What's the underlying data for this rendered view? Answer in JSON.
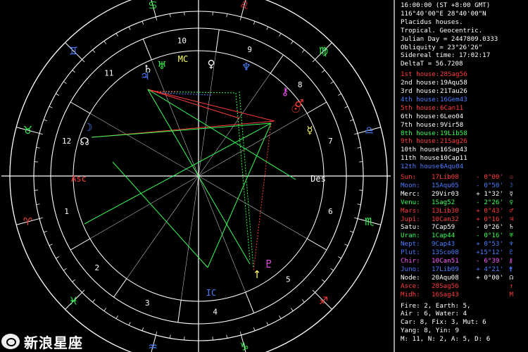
{
  "header": {
    "lines": [
      "16:00:00 (ST +8:00 GMT)",
      "116°40'00\"E 28°40'00\"N",
      "Placidus houses.",
      "Tropical. Geocentric.",
      "Julian Day = 2447809.0333",
      "Obliquity = 23°26'26\"",
      "Sidereal time: 17:02:17",
      "DeltaT = 56.7208"
    ]
  },
  "houses": [
    {
      "label": "1st house:",
      "value": "28Sag56",
      "color": "#ff3b3b"
    },
    {
      "label": "2nd house:",
      "value": "19Aqu58",
      "color": "#ffffff"
    },
    {
      "label": "3rd house:",
      "value": "21Tau26",
      "color": "#ffffff"
    },
    {
      "label": "4th house:",
      "value": "16Gem43",
      "color": "#4d7dff"
    },
    {
      "label": "5th house:",
      "value": "6Can11",
      "color": "#ff3b3b"
    },
    {
      "label": "6th house:",
      "value": "6Leo04",
      "color": "#ffffff"
    },
    {
      "label": "7th house:",
      "value": "9Vir58",
      "color": "#ffffff"
    },
    {
      "label": "8th house:",
      "value": "19Lib58",
      "color": "#33ff55"
    },
    {
      "label": "9th house:",
      "value": "21Sag26",
      "color": "#ff3b3b"
    },
    {
      "label": "10th house:",
      "value": "16Sag43",
      "color": "#ffffff"
    },
    {
      "label": "11th house:",
      "value": "10Cap11",
      "color": "#ffffff"
    },
    {
      "label": "12th house:",
      "value": "6Aqu04",
      "color": "#4d7dff"
    }
  ],
  "planets": [
    {
      "name": "Sun:",
      "pos": "17Lib08",
      "lat": "- 0°00'",
      "color": "#ff3b3b",
      "glyph": "☉"
    },
    {
      "name": "Moon:",
      "pos": "15Aqu05",
      "lat": "- 0°50'",
      "color": "#4d7dff",
      "glyph": "☽"
    },
    {
      "name": "Merc:",
      "pos": "29Vir03",
      "lat": "+ 1°32'",
      "color": "#ffffff",
      "glyph": "☿"
    },
    {
      "name": "Venu:",
      "pos": "1Sag52",
      "lat": "- 2°26'",
      "color": "#33ff55",
      "glyph": "♀"
    },
    {
      "name": "Mars:",
      "pos": "13Lib30",
      "lat": "+ 0°43'",
      "color": "#ff3b3b",
      "glyph": "♂"
    },
    {
      "name": "Jupi:",
      "pos": "10Can32",
      "lat": "+ 0°16'",
      "color": "#ff3b3b",
      "glyph": "♃"
    },
    {
      "name": "Satu:",
      "pos": "7Cap59",
      "lat": "- 0°26'",
      "color": "#ffffff",
      "glyph": "♄"
    },
    {
      "name": "Uran:",
      "pos": "1Cap44",
      "lat": "- 0°16'",
      "color": "#33ff55",
      "glyph": "♅"
    },
    {
      "name": "Nept:",
      "pos": "9Cap43",
      "lat": "+ 0°53'",
      "color": "#4d7dff",
      "glyph": "♆"
    },
    {
      "name": "Plut:",
      "pos": "13Sco08",
      "lat": "+15°12'",
      "color": "#4d7dff",
      "glyph": "♇"
    },
    {
      "name": "Chir:",
      "pos": "10Can51",
      "lat": "- 6°39'",
      "color": "#ff55ff",
      "glyph": "⚷"
    },
    {
      "name": "Juno:",
      "pos": "17Lib09",
      "lat": "+ 4°21'",
      "color": "#4d7dff",
      "glyph": "⚵"
    },
    {
      "name": "Node:",
      "pos": "20Aqu08",
      "lat": "+ 0°00'",
      "color": "#ffffff",
      "glyph": "☊"
    },
    {
      "name": "Asce:",
      "pos": "28Sag56",
      "lat": "",
      "color": "#ff3b3b",
      "glyph": "↑"
    },
    {
      "name": "Midh:",
      "pos": "16Sag43",
      "lat": "",
      "color": "#ff3b3b",
      "glyph": "M"
    }
  ],
  "footer": {
    "lines": [
      "Fire: 2, Earth: 5,",
      "Air : 6, Water: 4",
      "Car: 8, Fix: 3, Mut: 6",
      "Yang: 8, Yin: 9",
      "M: 11, N: 2, A: 5, D: 6"
    ]
  },
  "wheel": {
    "angle_labels": {
      "asc": "Asc",
      "desc": "Des",
      "mc": "MC",
      "ic": "IC"
    },
    "house_numbers": [
      "1",
      "2",
      "3",
      "4",
      "5",
      "6",
      "7",
      "8",
      "9",
      "10",
      "11",
      "12"
    ],
    "signs": [
      {
        "glyph": "♈",
        "color": "#ff3b3b"
      },
      {
        "glyph": "♉",
        "color": "#33ff55"
      },
      {
        "glyph": "♊",
        "color": "#4d7dff"
      },
      {
        "glyph": "♋",
        "color": "#33ff55"
      },
      {
        "glyph": "♌",
        "color": "#ff3b3b"
      },
      {
        "glyph": "♍",
        "color": "#33ff55"
      },
      {
        "glyph": "♎",
        "color": "#4d7dff"
      },
      {
        "glyph": "♏",
        "color": "#33ff55"
      },
      {
        "glyph": "♐",
        "color": "#ff3b3b"
      },
      {
        "glyph": "♑",
        "color": "#33ff55"
      },
      {
        "glyph": "♒",
        "color": "#4d7dff"
      },
      {
        "glyph": "♓",
        "color": "#33ff55"
      }
    ]
  },
  "watermark": {
    "text": "新浪星座"
  },
  "colors": {
    "background": "#000000",
    "circle": "#ffffff"
  }
}
